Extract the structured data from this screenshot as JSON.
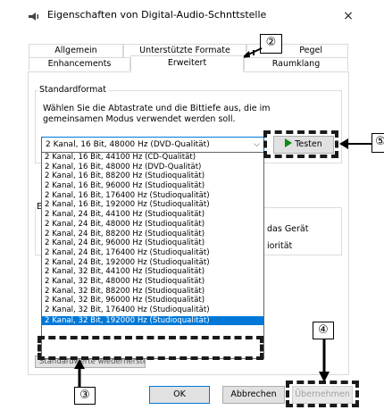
{
  "window": {
    "title": "Eigenschaften von Digital-Audio-Schnttstelle",
    "close_symbol": "×"
  },
  "tabs": {
    "allgemein": "Allgemein",
    "unterstuetzte": "Unterstützte Formate",
    "pegel": "Pegel",
    "enhancements": "Enhancements",
    "erweitert": "Erweitert",
    "raumklang": "Raumklang"
  },
  "standardformat": {
    "legend": "Standardformat",
    "description_line1": "Wählen Sie die Abtastrate und die Bittiefe aus, die im",
    "description_line2": "gemeinsamen Modus verwendet werden soll.",
    "selected_value": "2 Kanal, 16 Bit, 48000 Hz (DVD-Qualität)",
    "test_button": "Testen"
  },
  "dropdown_options": [
    "2 Kanal, 16 Bit, 44100 Hz (CD-Qualität)",
    "2 Kanal, 16 Bit, 48000 Hz (DVD-Qualität)",
    "2 Kanal, 16 Bit, 88200 Hz (Studioqualität)",
    "2 Kanal, 16 Bit, 96000 Hz (Studioqualität)",
    "2 Kanal, 16 Bit, 176400 Hz (Studioqualität)",
    "2 Kanal, 16 Bit, 192000 Hz (Studioqualität)",
    "2 Kanal, 24 Bit, 44100 Hz (Studioqualität)",
    "2 Kanal, 24 Bit, 48000 Hz (Studioqualität)",
    "2 Kanal, 24 Bit, 88200 Hz (Studioqualität)",
    "2 Kanal, 24 Bit, 96000 Hz (Studioqualität)",
    "2 Kanal, 24 Bit, 176400 Hz (Studioqualität)",
    "2 Kanal, 24 Bit, 192000 Hz (Studioqualität)",
    "2 Kanal, 32 Bit, 44100 Hz (Studioqualität)",
    "2 Kanal, 32 Bit, 48000 Hz (Studioqualität)",
    "2 Kanal, 32 Bit, 88200 Hz (Studioqualität)",
    "2 Kanal, 32 Bit, 96000 Hz (Studioqualität)",
    "2 Kanal, 32 Bit, 176400 Hz (Studioqualität)",
    "2 Kanal, 32 Bit, 192000 Hz (Studioqualität)"
  ],
  "selected_option_index": 17,
  "behind": {
    "exklusiv_letter": "E",
    "line_a": "das Gerät",
    "line_b": "iorität",
    "restore_button": "Standardwerte wiederherstellen"
  },
  "buttons": {
    "ok": "OK",
    "cancel": "Abbrechen",
    "apply": "Übernehmen"
  },
  "annotations": {
    "callout_2": "②",
    "callout_3": "③",
    "callout_4": "④",
    "callout_5": "⑤"
  },
  "colors": {
    "accent": "#0078d7",
    "play_green": "#0e8a16"
  }
}
